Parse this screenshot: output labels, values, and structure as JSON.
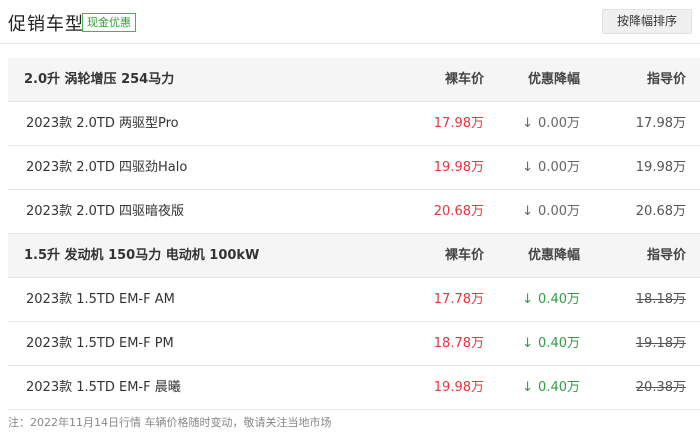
{
  "header": {
    "title": "促销车型",
    "badge": "现金优惠",
    "sort_button": "按降幅排序"
  },
  "groups": [
    {
      "title": "2.0升 涡轮增压 254马力",
      "col_price": "裸车价",
      "col_discount": "优惠降幅",
      "col_guide": "指导价",
      "rows": [
        {
          "name": "2023款 2.0TD 两驱型Pro",
          "price": "17.98万",
          "discount": "0.00万",
          "guide": "17.98万"
        },
        {
          "name": "2023款 2.0TD 四驱劲Halo",
          "price": "19.98万",
          "discount": "0.00万",
          "guide": "19.98万"
        },
        {
          "name": "2023款 2.0TD 四驱暗夜版",
          "price": "20.68万",
          "discount": "0.00万",
          "guide": "20.68万"
        }
      ]
    },
    {
      "title": "1.5升 发动机 150马力 电动机 100kW",
      "col_price": "裸车价",
      "col_discount": "优惠降幅",
      "col_guide": "指导价",
      "rows": [
        {
          "name": "2023款 1.5TD EM-F AM",
          "price": "17.78万",
          "discount": "0.40万",
          "guide": "18.18万"
        },
        {
          "name": "2023款 1.5TD EM-F PM",
          "price": "18.78万",
          "discount": "0.40万",
          "guide": "19.18万"
        },
        {
          "name": "2023款 1.5TD EM-F 晨曦",
          "price": "19.98万",
          "discount": "0.40万",
          "guide": "20.38万"
        }
      ]
    }
  ],
  "arrow_glyph": "↓",
  "note": "注：2022年11月14日行情 车辆价格随时变动，敬请关注当地市场",
  "colors": {
    "price": "#e8343f",
    "discount_positive": "#2f9e45",
    "badge_border": "#4caf50"
  }
}
